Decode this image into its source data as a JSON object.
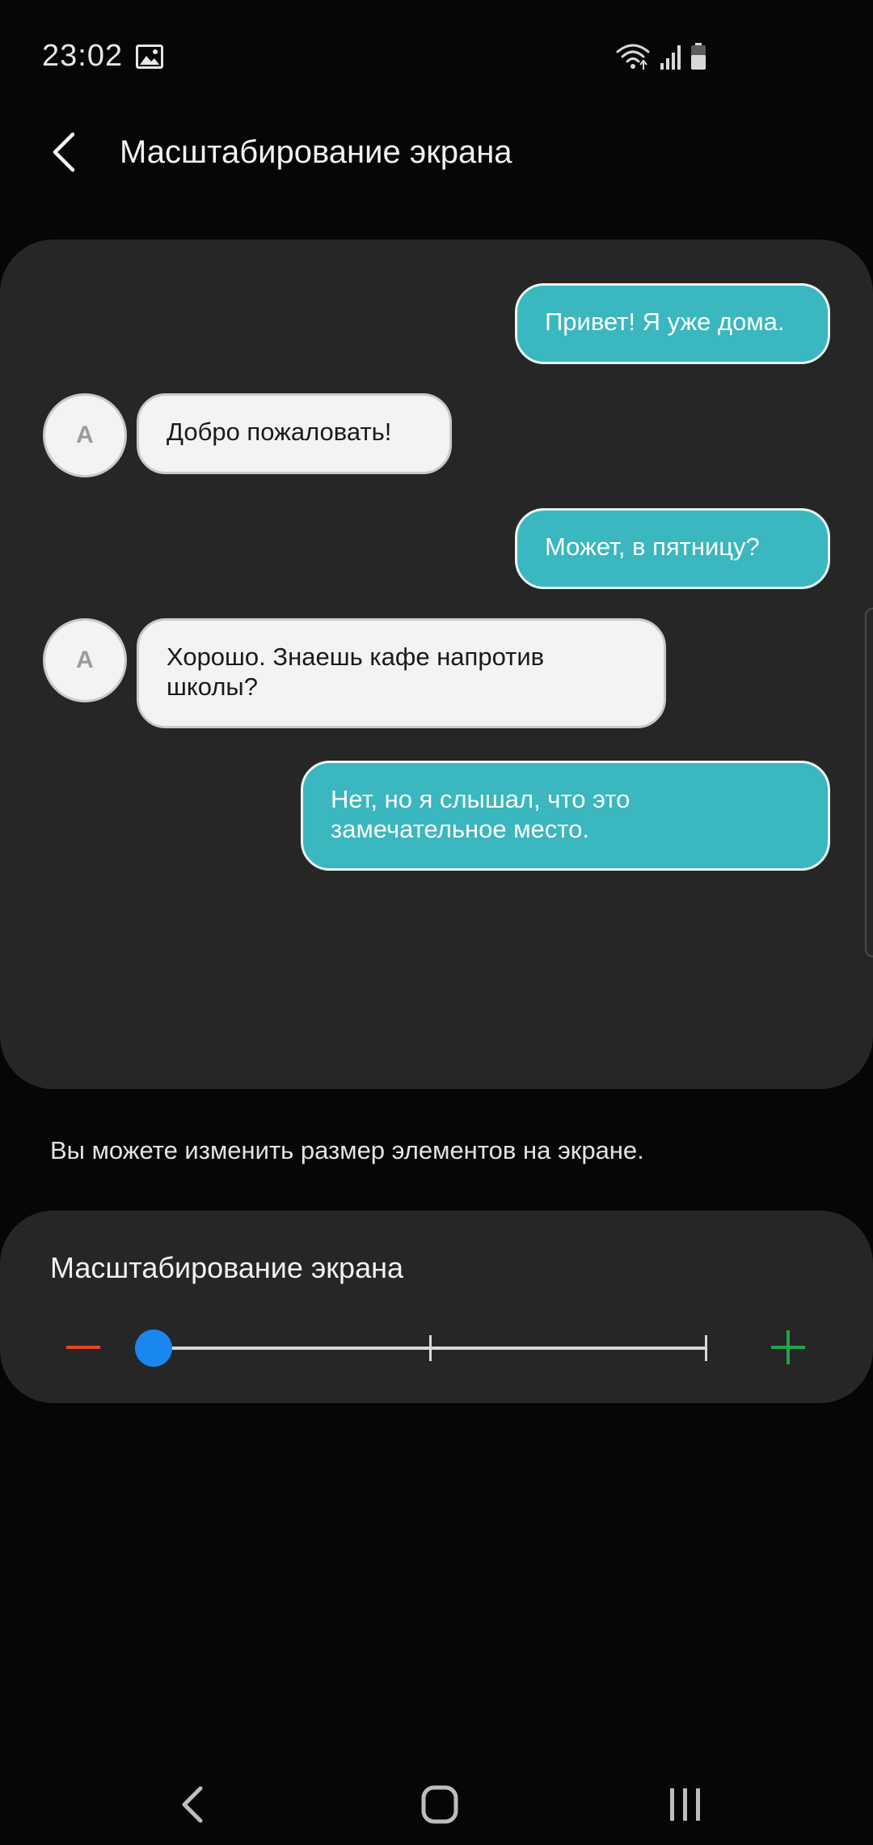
{
  "status_bar": {
    "time": "23:02",
    "icons": [
      "image-icon",
      "wifi-icon",
      "signal-icon",
      "battery-icon"
    ]
  },
  "header": {
    "title": "Масштабирование экрана",
    "back_icon": "chevron-left-icon"
  },
  "preview": {
    "messages": [
      {
        "side": "out",
        "text": "Привет! Я уже дома."
      },
      {
        "side": "in",
        "avatar": "A",
        "text": "Добро пожаловать!"
      },
      {
        "side": "out",
        "text": "Может, в пятницу?"
      },
      {
        "side": "in",
        "avatar": "A",
        "text": "Хорошо. Знаешь кафе напротив школы?"
      },
      {
        "side": "out",
        "text": "Нет, но я слышал, что это замечательное место."
      }
    ]
  },
  "description": "Вы можете изменить размер элементов на экране.",
  "zoom": {
    "title": "Масштабирование экрана",
    "steps": 3,
    "current_step": 0,
    "colors": {
      "minus": "#e8451e",
      "plus": "#1fa548",
      "thumb": "#1a86f0"
    }
  },
  "nav": {
    "icons": [
      "back-icon",
      "home-icon",
      "recent-apps-icon"
    ]
  },
  "colors": {
    "outgoing_bubble": "#3ab7bf",
    "incoming_bubble": "#f3f3f3",
    "card_background": "#262626",
    "page_background": "#060606"
  }
}
